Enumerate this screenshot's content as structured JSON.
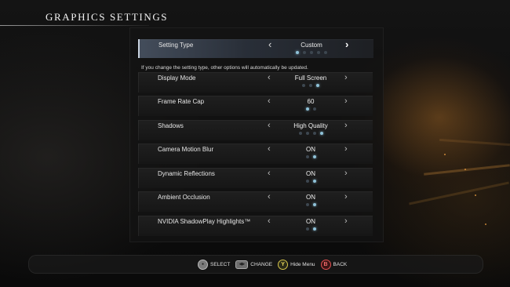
{
  "screen_title": "GRAPHICS SETTINGS",
  "setting_type": {
    "label": "Setting Type",
    "value": "Custom",
    "dots_total": 5,
    "dots_on": 1
  },
  "notice": "If you change the setting type, other options will automatically be updated.",
  "settings": [
    {
      "label": "Display Mode",
      "value": "Full Screen",
      "dots_total": 3,
      "dots_on": 3
    },
    {
      "label": "Frame Rate Cap",
      "value": "60",
      "dots_total": 2,
      "dots_on": 1
    },
    {
      "label": "Shadows",
      "value": "High Quality",
      "dots_total": 4,
      "dots_on": 4
    },
    {
      "label": "Camera Motion Blur",
      "value": "ON",
      "dots_total": 2,
      "dots_on": 2
    },
    {
      "label": "Dynamic Reflections",
      "value": "ON",
      "dots_total": 2,
      "dots_on": 2
    },
    {
      "label": "Ambient Occlusion",
      "value": "ON",
      "dots_total": 2,
      "dots_on": 2
    },
    {
      "label": "NVIDIA ShadowPlay Highlights™",
      "value": "ON",
      "dots_total": 2,
      "dots_on": 2
    }
  ],
  "arrows": {
    "left": "‹",
    "right": "›"
  },
  "controls": [
    {
      "button": "left-stick",
      "label": "SELECT"
    },
    {
      "button": "dpad",
      "label": "CHANGE"
    },
    {
      "button": "Y",
      "label": "Hide Menu"
    },
    {
      "button": "B",
      "label": "BACK"
    }
  ],
  "colors": {
    "dot_on": "#8fc2d8",
    "dot_off": "#3d4750",
    "button_y": "#e9d85a",
    "button_b": "#f06a6a"
  }
}
